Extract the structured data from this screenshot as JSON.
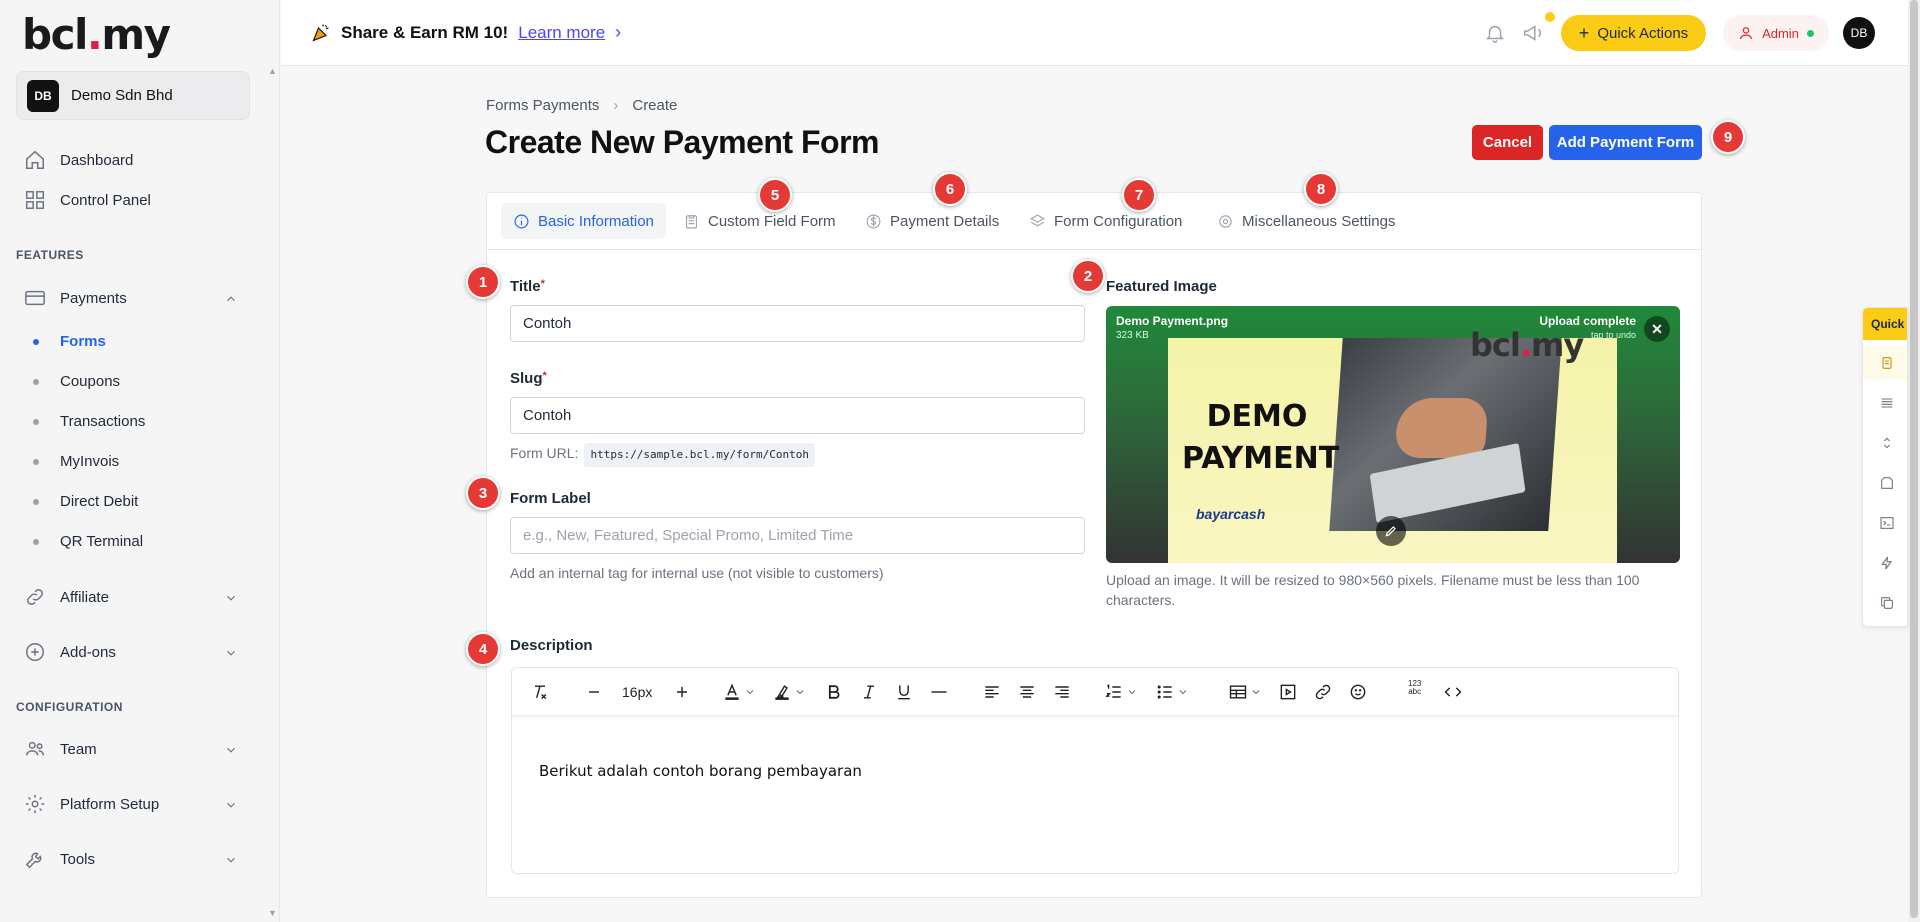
{
  "sidebar": {
    "logo_text": "bcl",
    "logo_dot": ".",
    "logo_suffix": "my",
    "company": {
      "avatar": "DB",
      "name": "Demo Sdn Bhd"
    },
    "main_items": [
      {
        "label": "Dashboard",
        "icon": "home-icon"
      },
      {
        "label": "Control Panel",
        "icon": "grid-icon"
      }
    ],
    "features_label": "FEATURES",
    "payments": {
      "label": "Payments",
      "icon": "credit-card-icon"
    },
    "payment_sub": [
      {
        "label": "Forms",
        "active": true
      },
      {
        "label": "Coupons"
      },
      {
        "label": "Transactions"
      },
      {
        "label": "MyInvois"
      },
      {
        "label": "Direct Debit"
      },
      {
        "label": "QR Terminal"
      }
    ],
    "affiliate": {
      "label": "Affiliate",
      "icon": "link-icon"
    },
    "addons": {
      "label": "Add-ons",
      "icon": "plus-circle-icon"
    },
    "configuration_label": "CONFIGURATION",
    "team": {
      "label": "Team",
      "icon": "users-icon"
    },
    "platform": {
      "label": "Platform Setup",
      "icon": "settings-icon"
    },
    "tools": {
      "label": "Tools",
      "icon": "tools-icon"
    }
  },
  "topbar": {
    "promo_text": "Share & Earn RM 10!",
    "promo_link": "Learn more",
    "quick_actions": "Quick Actions",
    "admin": "Admin",
    "user_avatar": "DB"
  },
  "breadcrumb": {
    "parent": "Forms Payments",
    "current": "Create"
  },
  "page_title": "Create New Payment Form",
  "actions": {
    "cancel": "Cancel",
    "add": "Add Payment Form"
  },
  "tabs": [
    {
      "label": "Basic Information",
      "active": true
    },
    {
      "label": "Custom Field Form"
    },
    {
      "label": "Payment Details"
    },
    {
      "label": "Form Configuration"
    },
    {
      "label": "Miscellaneous Settings"
    }
  ],
  "form": {
    "title_label": "Title",
    "title_value": "Contoh",
    "slug_label": "Slug",
    "slug_value": "Contoh",
    "form_url_label": "Form URL:",
    "form_url": "https://sample.bcl.my/form/Contoh",
    "label_label": "Form Label",
    "label_placeholder": "e.g., New, Featured, Special Promo, Limited Time",
    "label_help": "Add an internal tag for internal use (not visible to customers)",
    "required_mark": "*",
    "featured_label": "Featured Image",
    "image": {
      "file_name": "Demo Payment.png",
      "file_size": "323 KB",
      "status": "Upload complete",
      "undo": "tap to undo",
      "demo_line1": "DEMO",
      "demo_line2": "PAYMENT",
      "brand": "bayarcash"
    },
    "image_help": "Upload an image. It will be resized to 980×560 pixels. Filename must be less than 100 characters.",
    "description_label": "Description",
    "font_size": "16px",
    "description_text": "Berikut adalah contoh borang pembayaran"
  },
  "steps": [
    "1",
    "2",
    "3",
    "4",
    "5",
    "6",
    "7",
    "8",
    "9"
  ],
  "quick_panel_label": "Quick",
  "colors": {
    "accent": "#2563eb",
    "danger": "#dc2626",
    "highlight": "#facc15",
    "step": "#e53935"
  }
}
